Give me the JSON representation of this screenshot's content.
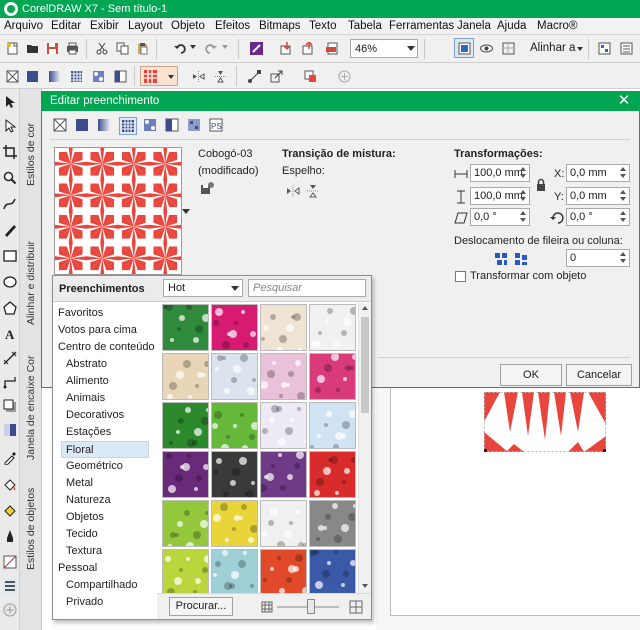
{
  "app": {
    "title": "CorelDRAW X7 - Sem título-1"
  },
  "menu": [
    "Arquivo",
    "Editar",
    "Exibir",
    "Layout",
    "Objeto",
    "Efeitos",
    "Bitmaps",
    "Texto",
    "Tabela",
    "Ferramentas",
    "Janela",
    "Ajuda",
    "Macro®"
  ],
  "toolbar": {
    "zoom": "46%",
    "align_label": "Alinhar a"
  },
  "dockers": [
    "Estilos de cor",
    "Alinhar e distribuir",
    "Janela de encaixe Cor",
    "Estilos de objetos"
  ],
  "dialog": {
    "title": "Editar preenchimento",
    "pattern_name": "Cobogó-03",
    "pattern_state": "(modificado)",
    "blend_title": "Transição de mistura:",
    "mirror_label": "Espelho:",
    "transform_title": "Transformações:",
    "width": "100,0 mm",
    "height": "100,0 mm",
    "x": "0,0 mm",
    "y": "0,0 mm",
    "skew": "0,0 °",
    "rotate": "0,0 °",
    "offset_title": "Deslocamento de fileira ou coluna:",
    "offset_value": "0",
    "transform_with_object": "Transformar com objeto",
    "ok": "OK",
    "cancel": "Cancelar",
    "colors": {
      "accent": "#00a651",
      "pattern_red": "#e8453c"
    }
  },
  "library": {
    "title": "Preenchimentos",
    "sort": "Hot",
    "search_placeholder": "Pesquisar",
    "tree": [
      "Favoritos",
      "Votos para cima",
      "Centro de conteúdo",
      "Abstrato",
      "Alimento",
      "Animais",
      "Decorativos",
      "Estações",
      "Floral",
      "Geométrico",
      "Metal",
      "Natureza",
      "Objetos",
      "Tecido",
      "Textura",
      "Pessoal",
      "Compartilhado",
      "Privado"
    ],
    "selected": "Floral",
    "browse": "Procurar...",
    "swatch_colors": [
      [
        "#2f8a3c",
        "#d81b72",
        "#efe3d4",
        "#f1f1f1"
      ],
      [
        "#e9d6b8",
        "#dbe4ee",
        "#e9c1d8",
        "#d93a7a"
      ],
      [
        "#2c8a2c",
        "#66b83a",
        "#eeeaf4",
        "#cfe3f3"
      ],
      [
        "#6a2a7a",
        "#3a3a3a",
        "#6f3a86",
        "#d82c2c"
      ],
      [
        "#93c83c",
        "#e9d53a",
        "#f0f0f0",
        "#888888"
      ],
      [
        "#b9d63c",
        "#9fd0d6",
        "#e04a2a",
        "#3a5aa8"
      ]
    ]
  }
}
